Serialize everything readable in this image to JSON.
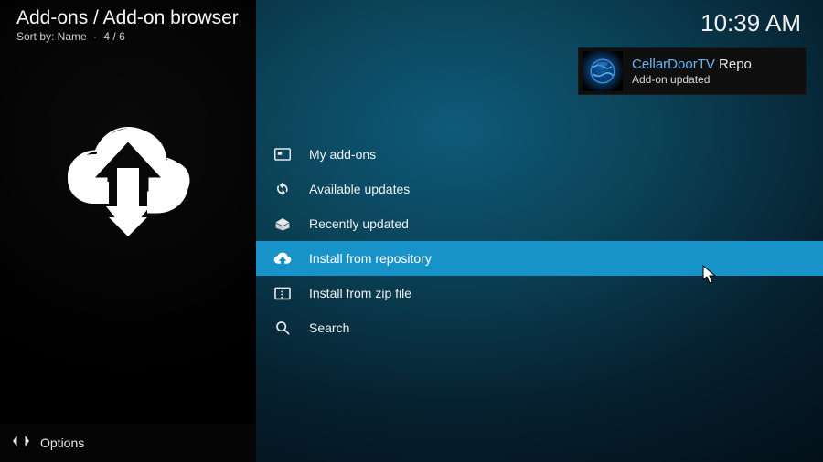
{
  "header": {
    "title": "Add-ons / Add-on browser",
    "sort_label": "Sort by: Name",
    "counter": "4 / 6"
  },
  "clock": "10:39 AM",
  "toast": {
    "title_accent": "CellarDoorTV",
    "title_suffix": " Repo",
    "message": "Add-on updated"
  },
  "menu": [
    {
      "key": "my-addons",
      "label": "My add-ons",
      "selected": false
    },
    {
      "key": "available-updates",
      "label": "Available updates",
      "selected": false
    },
    {
      "key": "recently-updated",
      "label": "Recently updated",
      "selected": false
    },
    {
      "key": "install-from-repository",
      "label": "Install from repository",
      "selected": true
    },
    {
      "key": "install-from-zip",
      "label": "Install from zip file",
      "selected": false
    },
    {
      "key": "search",
      "label": "Search",
      "selected": false
    }
  ],
  "footer": {
    "options_label": "Options"
  }
}
